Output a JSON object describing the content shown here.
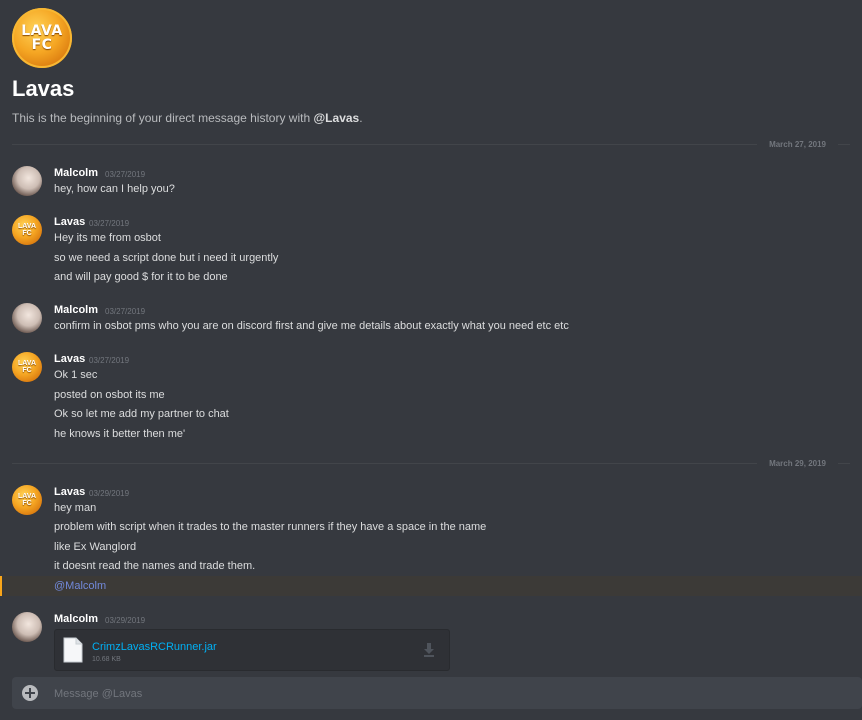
{
  "header": {
    "avatar_line1": "LAVA",
    "avatar_line2": "FC",
    "title": "Lavas",
    "intro_prefix": "This is the beginning of your direct message history with ",
    "intro_mention": "@Lavas",
    "intro_suffix": "."
  },
  "dividers": [
    {
      "label": "March 27, 2019"
    },
    {
      "label": "March 29, 2019"
    }
  ],
  "avatar_badge": {
    "line1": "LAVA",
    "line2": "FC"
  },
  "messages": [
    {
      "author": "Malcolm",
      "timestamp": "03/27/2019",
      "lines": [
        "hey, how can I help you?"
      ]
    },
    {
      "author": "Lavas",
      "timestamp": "03/27/2019",
      "lines": [
        "Hey its me from osbot",
        "so we need a script done but i need it urgently",
        "and will pay good $ for it to be done"
      ]
    },
    {
      "author": "Malcolm",
      "timestamp": "03/27/2019",
      "lines": [
        "confirm in osbot pms who you are on discord first and give me details about exactly what you need etc etc"
      ]
    },
    {
      "author": "Lavas",
      "timestamp": "03/27/2019",
      "lines": [
        "Ok 1 sec",
        "posted on osbot its me",
        "Ok so let me add my partner to chat",
        "he knows it better then me'"
      ]
    },
    {
      "author": "Lavas",
      "timestamp": "03/29/2019",
      "lines": [
        "hey man",
        "problem with script when it trades to the master runners if they have a space in the name",
        "like Ex Wanglord",
        "it doesnt read the names and trade them.",
        "@Malcolm"
      ]
    },
    {
      "author": "Malcolm",
      "timestamp": "03/29/2019",
      "lines": []
    }
  ],
  "attachment": {
    "file_name": "CrimzLavasRCRunner.jar",
    "file_size": "10.68 KB",
    "file_icon": "file-icon",
    "download_icon": "download-icon"
  },
  "composer": {
    "placeholder": "Message @Lavas",
    "attach_icon": "plus-circle-icon"
  },
  "colors": {
    "background": "#36393f",
    "mention": "#7289da",
    "link": "#00b0f4",
    "highlight_bar": "#faa61a"
  }
}
